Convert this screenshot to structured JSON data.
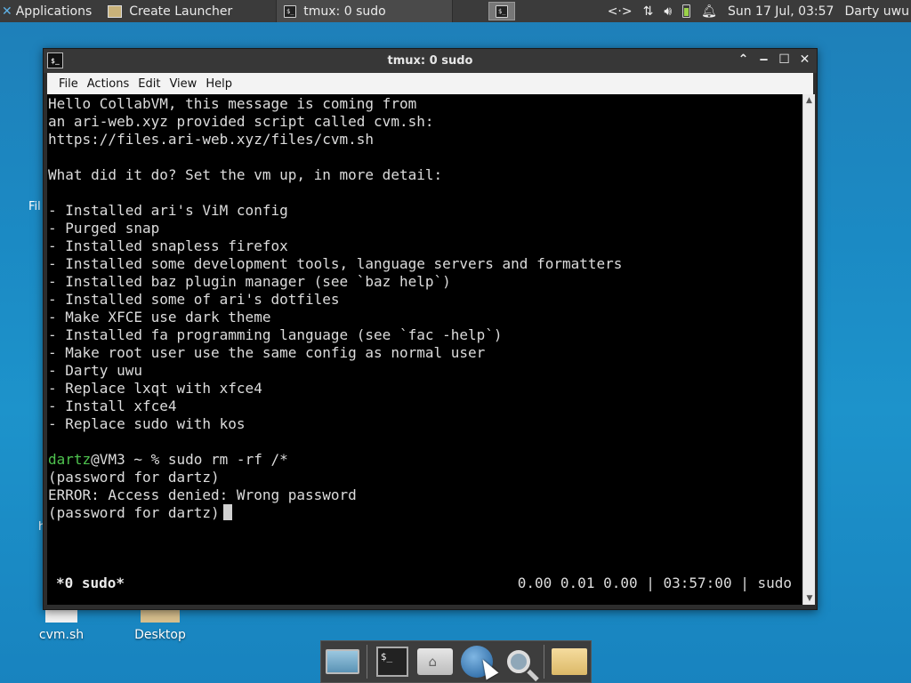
{
  "top_panel": {
    "applications_label": "Applications",
    "tasks": [
      {
        "label": "Create Launcher"
      },
      {
        "label": "tmux: 0 sudo"
      }
    ],
    "clock": "Sun 17 Jul, 03:57",
    "user": "Darty uwu",
    "network_symbol": "<·>",
    "transfer_symbol": "⇅"
  },
  "desktop": {
    "icons": [
      {
        "label": "cvm.sh"
      },
      {
        "label": "Desktop"
      }
    ],
    "partial_labels": [
      "Fil",
      "h"
    ]
  },
  "window": {
    "title": "tmux: 0 sudo",
    "menu": [
      "File",
      "Actions",
      "Edit",
      "View",
      "Help"
    ],
    "terminal_lines": [
      "Hello CollabVM, this message is coming from",
      "an ari-web.xyz provided script called cvm.sh:",
      "https://files.ari-web.xyz/files/cvm.sh",
      "",
      "What did it do? Set the vm up, in more detail:",
      "",
      "- Installed ari's ViM config",
      "- Purged snap",
      "- Installed snapless firefox",
      "- Installed some development tools, language servers and formatters",
      "- Installed baz plugin manager (see `baz help`)",
      "- Installed some of ari's dotfiles",
      "- Make XFCE use dark theme",
      "- Installed fa programming language (see `fac -help`)",
      "- Make root user use the same config as normal user",
      "- Darty uwu",
      "- Replace lxqt with xfce4",
      "- Install xfce4",
      "- Replace sudo with kos",
      ""
    ],
    "prompt": {
      "user": "dartz",
      "rest": "@VM3 ~ % sudo rm -rf /*"
    },
    "after_prompt": [
      "(password for dartz)",
      "ERROR: Access denied: Wrong password"
    ],
    "password_prompt": "(password for dartz)",
    "status_left": "*0 sudo*",
    "status_right": "0.00 0.01 0.00 | 03:57:00 | sudo"
  }
}
